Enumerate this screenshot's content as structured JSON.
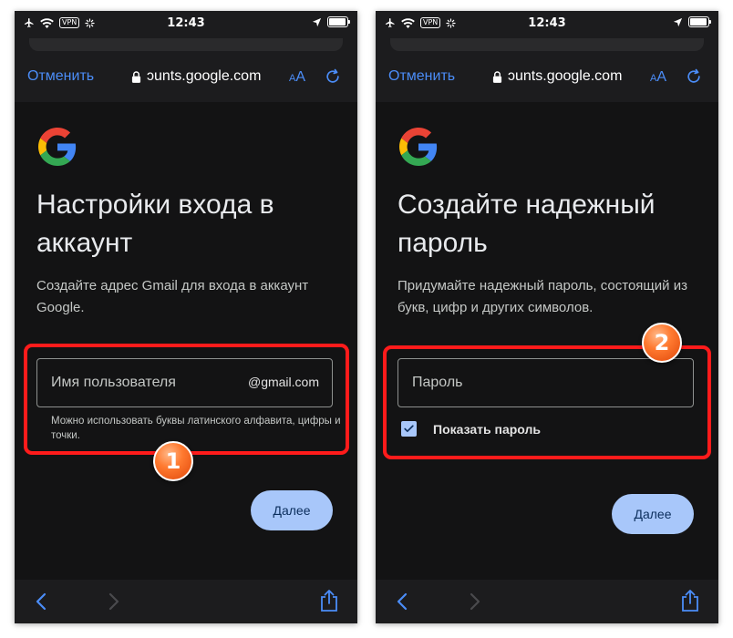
{
  "status_bar": {
    "time": "12:43",
    "vpn": "VPN"
  },
  "browser": {
    "cancel_label": "Отменить",
    "url": "ɔunts.google.com",
    "aa_small": "A",
    "aa_big": "A"
  },
  "screen_left": {
    "heading": "Настройки входа в аккаунт",
    "description": "Создайте адрес Gmail для входа в аккаунт Google.",
    "username_placeholder": "Имя пользователя",
    "username_suffix": "@gmail.com",
    "hint": "Можно использовать буквы латинского алфавита, цифры и точки.",
    "next_label": "Далее"
  },
  "screen_right": {
    "heading": "Создайте надежный пароль",
    "description": "Придумайте надежный пароль, состоящий из букв, цифр и других символов.",
    "password_placeholder": "Пароль",
    "show_password_label": "Показать пароль",
    "show_password_checked": true,
    "next_label": "Далее"
  },
  "markers": {
    "step_1": "1",
    "step_2": "2"
  },
  "colors": {
    "accent": "#4b8df8",
    "button": "#a8c7fa",
    "highlight": "#ff1b1b",
    "marker": "#ff7a30",
    "background": "#131314"
  },
  "icons": [
    "google-logo",
    "wifi-icon",
    "signal-icon",
    "location-icon",
    "battery-icon",
    "lock-icon",
    "reload-icon",
    "back-arrow-icon",
    "forward-arrow-icon",
    "share-icon",
    "checkmark-icon"
  ]
}
